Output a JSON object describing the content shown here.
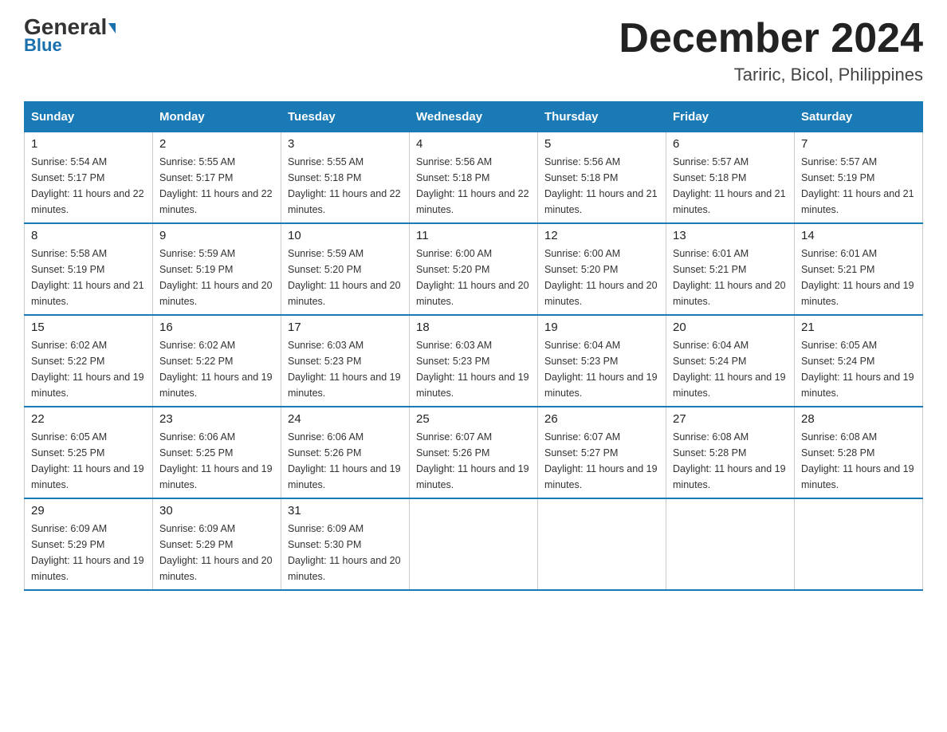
{
  "header": {
    "logo_general": "General",
    "logo_blue": "Blue",
    "title": "December 2024",
    "subtitle": "Tariric, Bicol, Philippines"
  },
  "days_of_week": [
    "Sunday",
    "Monday",
    "Tuesday",
    "Wednesday",
    "Thursday",
    "Friday",
    "Saturday"
  ],
  "weeks": [
    [
      {
        "day": 1,
        "sunrise": "5:54 AM",
        "sunset": "5:17 PM",
        "daylight": "11 hours and 22 minutes."
      },
      {
        "day": 2,
        "sunrise": "5:55 AM",
        "sunset": "5:17 PM",
        "daylight": "11 hours and 22 minutes."
      },
      {
        "day": 3,
        "sunrise": "5:55 AM",
        "sunset": "5:18 PM",
        "daylight": "11 hours and 22 minutes."
      },
      {
        "day": 4,
        "sunrise": "5:56 AM",
        "sunset": "5:18 PM",
        "daylight": "11 hours and 22 minutes."
      },
      {
        "day": 5,
        "sunrise": "5:56 AM",
        "sunset": "5:18 PM",
        "daylight": "11 hours and 21 minutes."
      },
      {
        "day": 6,
        "sunrise": "5:57 AM",
        "sunset": "5:18 PM",
        "daylight": "11 hours and 21 minutes."
      },
      {
        "day": 7,
        "sunrise": "5:57 AM",
        "sunset": "5:19 PM",
        "daylight": "11 hours and 21 minutes."
      }
    ],
    [
      {
        "day": 8,
        "sunrise": "5:58 AM",
        "sunset": "5:19 PM",
        "daylight": "11 hours and 21 minutes."
      },
      {
        "day": 9,
        "sunrise": "5:59 AM",
        "sunset": "5:19 PM",
        "daylight": "11 hours and 20 minutes."
      },
      {
        "day": 10,
        "sunrise": "5:59 AM",
        "sunset": "5:20 PM",
        "daylight": "11 hours and 20 minutes."
      },
      {
        "day": 11,
        "sunrise": "6:00 AM",
        "sunset": "5:20 PM",
        "daylight": "11 hours and 20 minutes."
      },
      {
        "day": 12,
        "sunrise": "6:00 AM",
        "sunset": "5:20 PM",
        "daylight": "11 hours and 20 minutes."
      },
      {
        "day": 13,
        "sunrise": "6:01 AM",
        "sunset": "5:21 PM",
        "daylight": "11 hours and 20 minutes."
      },
      {
        "day": 14,
        "sunrise": "6:01 AM",
        "sunset": "5:21 PM",
        "daylight": "11 hours and 19 minutes."
      }
    ],
    [
      {
        "day": 15,
        "sunrise": "6:02 AM",
        "sunset": "5:22 PM",
        "daylight": "11 hours and 19 minutes."
      },
      {
        "day": 16,
        "sunrise": "6:02 AM",
        "sunset": "5:22 PM",
        "daylight": "11 hours and 19 minutes."
      },
      {
        "day": 17,
        "sunrise": "6:03 AM",
        "sunset": "5:23 PM",
        "daylight": "11 hours and 19 minutes."
      },
      {
        "day": 18,
        "sunrise": "6:03 AM",
        "sunset": "5:23 PM",
        "daylight": "11 hours and 19 minutes."
      },
      {
        "day": 19,
        "sunrise": "6:04 AM",
        "sunset": "5:23 PM",
        "daylight": "11 hours and 19 minutes."
      },
      {
        "day": 20,
        "sunrise": "6:04 AM",
        "sunset": "5:24 PM",
        "daylight": "11 hours and 19 minutes."
      },
      {
        "day": 21,
        "sunrise": "6:05 AM",
        "sunset": "5:24 PM",
        "daylight": "11 hours and 19 minutes."
      }
    ],
    [
      {
        "day": 22,
        "sunrise": "6:05 AM",
        "sunset": "5:25 PM",
        "daylight": "11 hours and 19 minutes."
      },
      {
        "day": 23,
        "sunrise": "6:06 AM",
        "sunset": "5:25 PM",
        "daylight": "11 hours and 19 minutes."
      },
      {
        "day": 24,
        "sunrise": "6:06 AM",
        "sunset": "5:26 PM",
        "daylight": "11 hours and 19 minutes."
      },
      {
        "day": 25,
        "sunrise": "6:07 AM",
        "sunset": "5:26 PM",
        "daylight": "11 hours and 19 minutes."
      },
      {
        "day": 26,
        "sunrise": "6:07 AM",
        "sunset": "5:27 PM",
        "daylight": "11 hours and 19 minutes."
      },
      {
        "day": 27,
        "sunrise": "6:08 AM",
        "sunset": "5:28 PM",
        "daylight": "11 hours and 19 minutes."
      },
      {
        "day": 28,
        "sunrise": "6:08 AM",
        "sunset": "5:28 PM",
        "daylight": "11 hours and 19 minutes."
      }
    ],
    [
      {
        "day": 29,
        "sunrise": "6:09 AM",
        "sunset": "5:29 PM",
        "daylight": "11 hours and 19 minutes."
      },
      {
        "day": 30,
        "sunrise": "6:09 AM",
        "sunset": "5:29 PM",
        "daylight": "11 hours and 20 minutes."
      },
      {
        "day": 31,
        "sunrise": "6:09 AM",
        "sunset": "5:30 PM",
        "daylight": "11 hours and 20 minutes."
      },
      null,
      null,
      null,
      null
    ]
  ]
}
